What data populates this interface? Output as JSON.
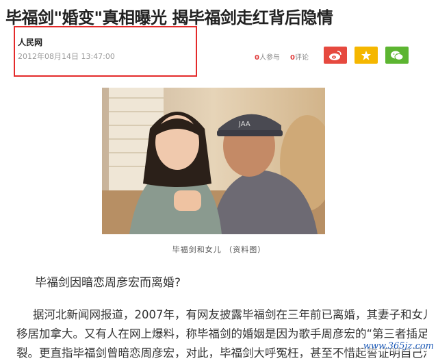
{
  "article": {
    "headline_part1": "毕福剑",
    "headline_quote": "\"婚变\"",
    "headline_part2": "真相曝光 揭毕福剑走红背后隐情",
    "source": "人民网",
    "timestamp": "2012年08月14日 13:47:00",
    "participants_count": "0",
    "participants_label": "人参与",
    "comments_count": "0",
    "comments_label": "评论",
    "photo_caption": "毕福剑和女儿 （资料图）",
    "subheading": "毕福剑因暗恋周彦宏而离婚?",
    "paragraph_lines": [
      "据河北新闻网报道，2007年，有网友披露毕福剑在三年前已离婚，其妻子和女儿已经",
      "移居加拿大。又有人在网上爆料，称毕福剑的婚姻是因为歌手周彦宏的“第三者插足”而破",
      "裂。更直指毕福剑曾暗恋周彦宏，对此，毕福剑大呼冤枉，甚至不惜起誓证明自己清白"
    ]
  },
  "share_buttons": [
    {
      "name": "weibo",
      "icon": "weibo-icon",
      "color": "#e6493f"
    },
    {
      "name": "favorite",
      "icon": "star-icon",
      "color": "#f5b700"
    },
    {
      "name": "wechat",
      "icon": "wechat-icon",
      "color": "#5cb531"
    }
  ],
  "watermark": "www.365jz.com",
  "colors": {
    "highlight_box": "#e42a2a",
    "count_red": "#e03a3a",
    "watermark_blue": "#1e5bb8"
  }
}
